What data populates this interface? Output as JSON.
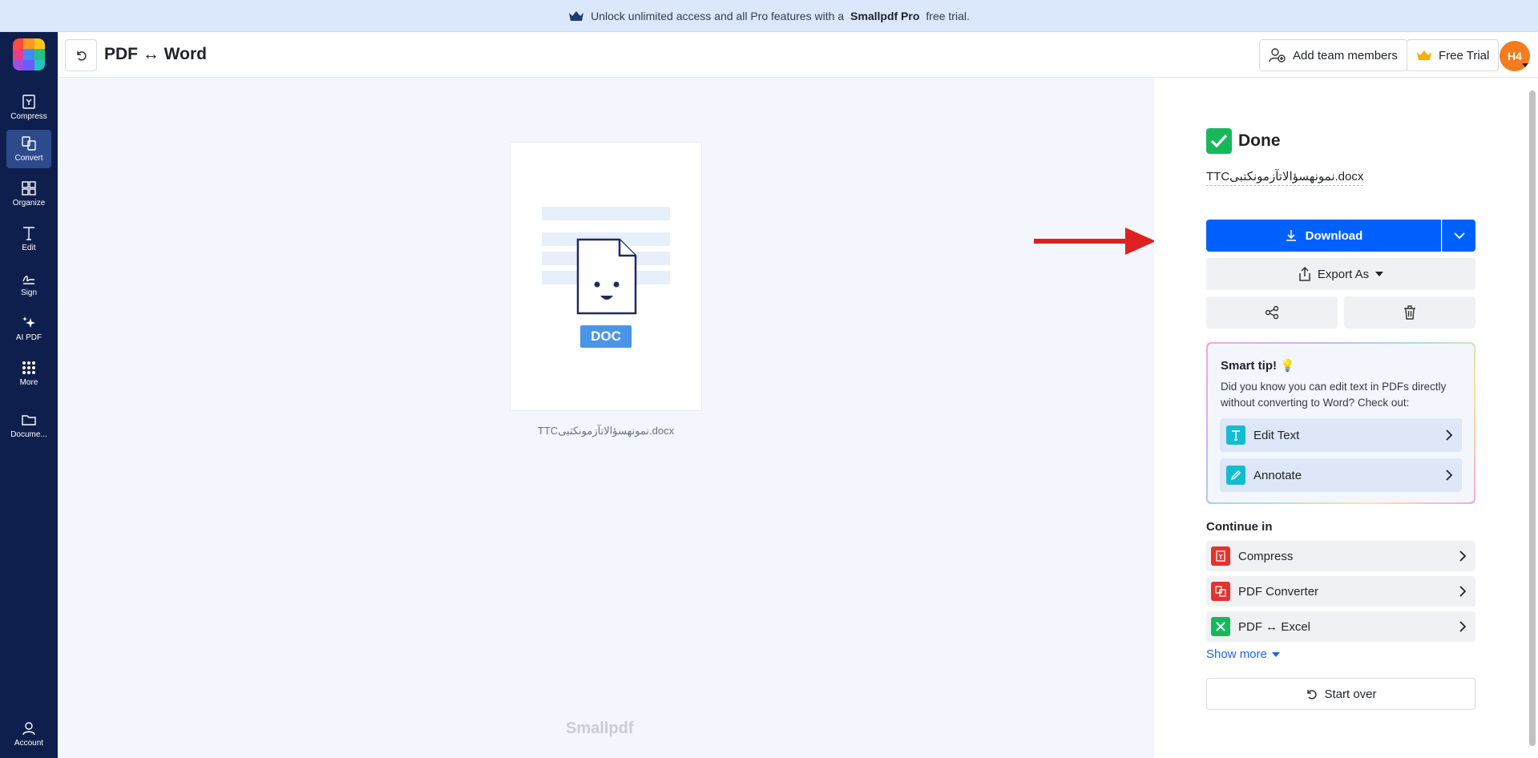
{
  "banner": {
    "text_before": "Unlock unlimited access and all Pro features with a",
    "brand": "Smallpdf Pro",
    "text_after": "free trial."
  },
  "sidebar": {
    "items": [
      {
        "label": "Compress",
        "icon": "compress-icon"
      },
      {
        "label": "Convert",
        "icon": "convert-icon",
        "active": true
      },
      {
        "label": "Organize",
        "icon": "organize-icon"
      },
      {
        "label": "Edit",
        "icon": "edit-icon"
      },
      {
        "label": "Sign",
        "icon": "sign-icon"
      },
      {
        "label": "AI PDF",
        "icon": "sparkle-icon"
      },
      {
        "label": "More",
        "icon": "grid-icon"
      },
      {
        "label": "Docume...",
        "icon": "folder-icon"
      }
    ],
    "account_label": "Account"
  },
  "header": {
    "title": "PDF ↔ Word",
    "add_team_label": "Add team members",
    "free_trial_label": "Free Trial",
    "avatar_initials": "H4"
  },
  "preview": {
    "badge": "DOC",
    "file_name": "TTCنمونهسؤالاتآزمونکتبی.docx",
    "watermark": "Smallpdf"
  },
  "result": {
    "status": "Done",
    "file_name": "TTCنمونهسؤالاتآزمونکتبی.docx",
    "download_label": "Download",
    "export_label": "Export As"
  },
  "smart_tip": {
    "title": "Smart tip! 💡",
    "text": "Did you know you can edit text in PDFs directly without converting to Word? Check out:",
    "links": [
      {
        "label": "Edit Text"
      },
      {
        "label": "Annotate"
      }
    ]
  },
  "continue_in": {
    "title": "Continue in",
    "items": [
      {
        "label": "Compress",
        "color": "#e5322d"
      },
      {
        "label": "PDF Converter",
        "color": "#e5322d"
      },
      {
        "label": "PDF ↔ Excel",
        "color": "#17b85b"
      }
    ],
    "show_more": "Show more"
  },
  "start_over_label": "Start over",
  "colors": {
    "accent": "#0061fe",
    "sidebar": "#0f1f4d",
    "success": "#17b85b",
    "arrow": "#e02020"
  }
}
